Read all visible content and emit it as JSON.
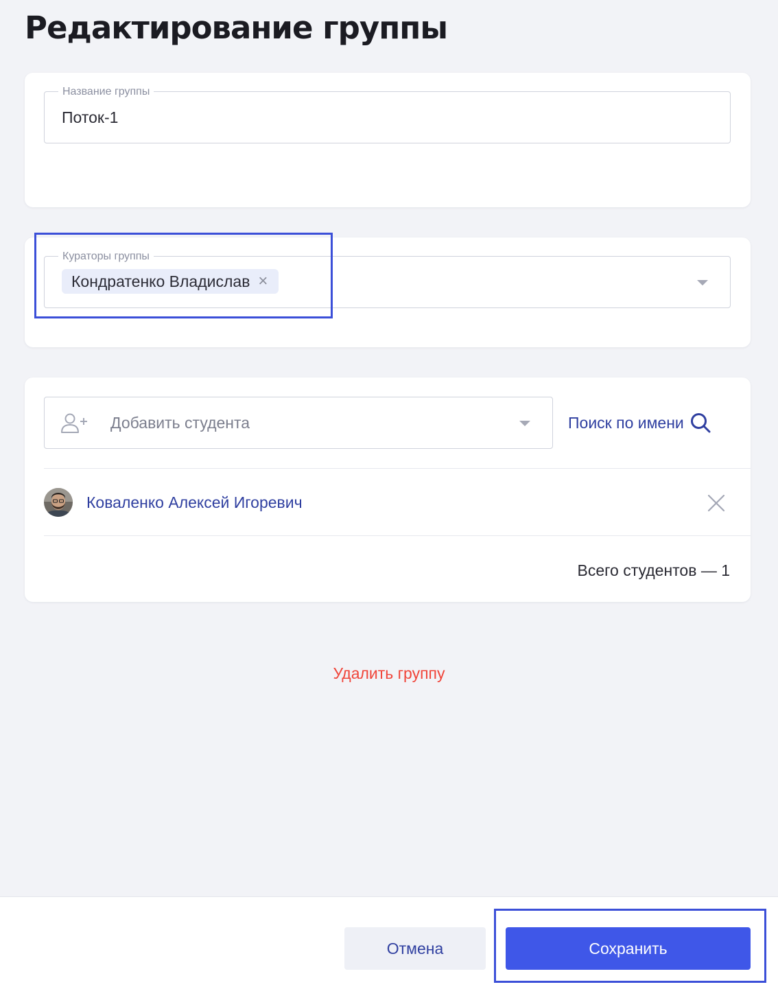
{
  "page": {
    "title": "Редактирование группы"
  },
  "group_name": {
    "label": "Название группы",
    "value": "Поток-1"
  },
  "curators": {
    "label": "Кураторы группы",
    "selected": [
      {
        "name": "Кондратенко Владислав",
        "remove_symbol": "×"
      }
    ]
  },
  "students": {
    "add_placeholder": "Добавить студента",
    "add_icon": "user-plus-icon",
    "search_label": "Поиск по имени",
    "search_icon": "search-icon",
    "list": [
      {
        "name": "Коваленко Алексей Игоревич",
        "avatar": "avatar-photo"
      }
    ],
    "total_label": "Всего студентов — 1"
  },
  "actions": {
    "delete_group": "Удалить группу",
    "cancel": "Отмена",
    "save": "Сохранить"
  },
  "colors": {
    "background": "#f2f3f7",
    "accent": "#3f57e8",
    "link": "#2f3fa0",
    "danger": "#f0453a",
    "highlight": "#3b4fd8"
  }
}
